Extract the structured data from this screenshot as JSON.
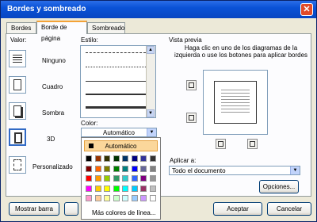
{
  "window": {
    "title": "Bordes y sombreado",
    "close_glyph": "✕"
  },
  "tabs": [
    {
      "label": "Bordes"
    },
    {
      "label": "Borde de página"
    },
    {
      "label": "Sombreado"
    }
  ],
  "settings": {
    "label": "Valor:",
    "items": [
      {
        "label": "Ninguno"
      },
      {
        "label": "Cuadro"
      },
      {
        "label": "Sombra"
      },
      {
        "label": "3D"
      },
      {
        "label": "Personalizado"
      }
    ]
  },
  "style": {
    "label": "Estilo:"
  },
  "color": {
    "label": "Color:",
    "value": "Automático",
    "palette_auto": "Automático",
    "more": "Más colores de línea...",
    "swatches": [
      "#000000",
      "#993300",
      "#333300",
      "#003300",
      "#003366",
      "#000080",
      "#333399",
      "#333333",
      "#800000",
      "#ff6600",
      "#808000",
      "#008000",
      "#008080",
      "#0000ff",
      "#666699",
      "#808080",
      "#ff0000",
      "#ff9900",
      "#99cc00",
      "#339966",
      "#33cccc",
      "#3366ff",
      "#800080",
      "#969696",
      "#ff00ff",
      "#ffcc00",
      "#ffff00",
      "#00ff00",
      "#00ffff",
      "#00ccff",
      "#993366",
      "#c0c0c0",
      "#ff99cc",
      "#ffcc99",
      "#ffff99",
      "#ccffcc",
      "#ccffff",
      "#99ccff",
      "#cc99ff",
      "#ffffff"
    ]
  },
  "preview": {
    "label": "Vista previa",
    "hint": "Haga clic en uno de los diagramas de la izquierda o use los botones para aplicar bordes"
  },
  "apply": {
    "label": "Aplicar a:",
    "value": "Todo el documento"
  },
  "buttons": {
    "options": "Opciones...",
    "show_bar": "Mostrar barra",
    "accept": "Aceptar",
    "cancel": "Cancelar"
  }
}
